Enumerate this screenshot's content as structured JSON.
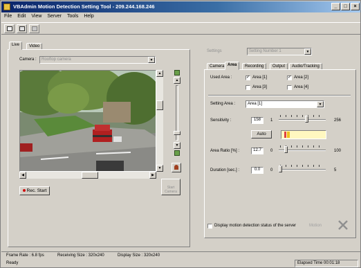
{
  "window": {
    "title": "VBAdmin Motion Detection Setting Tool - 209.244.168.246",
    "controls": [
      "_",
      "□",
      "×"
    ]
  },
  "menu": [
    "File",
    "Edit",
    "View",
    "Server",
    "Tools",
    "Help"
  ],
  "left_panel": {
    "tabs": [
      "Live",
      "Video"
    ],
    "camera_label": "Camera :",
    "camera_value": "Rooftop camera",
    "rec_start_label": "Rec. Start",
    "right_button_label": "Start Camera"
  },
  "right_panel": {
    "settings_label": "Settings",
    "settings_value": "Setting Number 1",
    "tabs": [
      "Camera",
      "Area",
      "Recording",
      "Output",
      "Audio/Tracking"
    ],
    "used_area_label": "Used Area :",
    "areas": [
      {
        "label": "Area [1]",
        "checked": true
      },
      {
        "label": "Area [2]",
        "checked": true
      },
      {
        "label": "Area [3]",
        "checked": false
      },
      {
        "label": "Area [4]",
        "checked": false
      }
    ],
    "setting_area_label": "Setting Area :",
    "setting_area_value": "Area [1]",
    "sensitivity": {
      "label": "Sensitivity :",
      "value": "158",
      "min": "1",
      "max": "256",
      "level": 0.61
    },
    "auto_label": "Auto",
    "area_ratio": {
      "label": "Area Ratio [%] :",
      "value": "12.7",
      "min": "0",
      "max": "100",
      "level": 0.13
    },
    "duration": {
      "label": "Duration [sec.] :",
      "value": "0.0",
      "min": "0",
      "max": "5",
      "level": 0.0
    },
    "display_motion_label": "Display motion detection status of the server",
    "motion_label": "Motion"
  },
  "info_bar": {
    "frame_rate": "Frame Rate : 6.8 fps",
    "receiving_size": "Receiving Size : 320x240",
    "display_size": "Display Size : 320x240"
  },
  "status_bar": {
    "status": "Ready",
    "elapsed": "Elapsed Time 00:01:18"
  }
}
